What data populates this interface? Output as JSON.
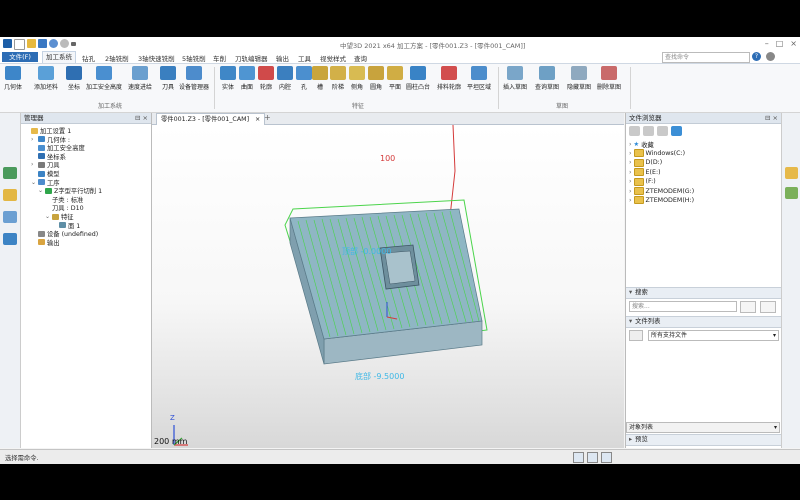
{
  "window": {
    "title": "中望3D 2021 x64        加工方案 - [零件001.Z3 - [零件001_CAM]]",
    "search_placeholder": "查找命令"
  },
  "menu": {
    "file": "文件(F)",
    "tabs": [
      "加工系统",
      "钻孔",
      "2轴铣削",
      "3轴快速铣削",
      "5轴铣削",
      "车削",
      "刀轨编辑器",
      "输出",
      "工具",
      "视觉样式",
      "查询"
    ]
  },
  "ribbon": {
    "system_buttons": [
      "几何体",
      "添加坯料",
      "坐标",
      "加工安全高度",
      "速度进给",
      "刀具",
      "设备管理器"
    ],
    "system_group": "加工系统",
    "feature_buttons": [
      "实体",
      "曲面",
      "轮廓",
      "内腔",
      "孔",
      "槽",
      "阶梯",
      "侧角",
      "圆角",
      "平面",
      "圆柱凸台",
      "排料轮廓",
      "平坦区域"
    ],
    "feature_group": "特征",
    "group3_buttons": [
      "插入草图",
      "查询草图",
      "隐藏草图",
      "删除草图"
    ],
    "group3_label": "草图"
  },
  "manager": {
    "title": "管理器",
    "tree": [
      {
        "label": "加工设置 1",
        "indent": 0,
        "icon": "folder-icon",
        "chev": ""
      },
      {
        "label": "几何体 :",
        "indent": 1,
        "icon": "geometry-icon",
        "chev": "›"
      },
      {
        "label": "加工安全高度",
        "indent": 1,
        "icon": "safe-height-icon",
        "chev": ""
      },
      {
        "label": "坐标系",
        "indent": 1,
        "icon": "coordinate-icon",
        "chev": ""
      },
      {
        "label": "刀具",
        "indent": 1,
        "icon": "tool-icon",
        "chev": "›"
      },
      {
        "label": "模型",
        "indent": 1,
        "icon": "model-icon",
        "chev": ""
      },
      {
        "label": "工序",
        "indent": 1,
        "icon": "operation-icon",
        "chev": "⌄"
      },
      {
        "label": "Z字型平行切削 1",
        "indent": 2,
        "icon": "check-icon",
        "chev": "⌄"
      },
      {
        "label": "子类 : 标准",
        "indent": 3,
        "icon": "",
        "chev": ""
      },
      {
        "label": "刀具 : D10",
        "indent": 3,
        "icon": "",
        "chev": ""
      },
      {
        "label": "特征",
        "indent": 3,
        "icon": "feature-icon",
        "chev": "⌄"
      },
      {
        "label": "面 1",
        "indent": 4,
        "icon": "face-icon",
        "chev": ""
      },
      {
        "label": "设备 (undefined)",
        "indent": 1,
        "icon": "device-icon",
        "chev": ""
      },
      {
        "label": "输出",
        "indent": 1,
        "icon": "output-icon",
        "chev": ""
      }
    ]
  },
  "doc": {
    "tab_label": "零件001.Z3 - [零件001_CAM]",
    "close": "×",
    "add": "+"
  },
  "viewport": {
    "dim_label": "100",
    "top_label": "顶部 -0.0000",
    "bottom_label": "底部 -9.5000",
    "scale_label": "200 mm",
    "axis_z": "Z"
  },
  "file_browser": {
    "title": "文件浏览器",
    "items": [
      "收藏",
      "Windows(C:)",
      "D(D:)",
      "E(E:)",
      "(F:)",
      "ZTEMODEM(G:)",
      "ZTEMODEM(H:)"
    ],
    "search_header": "搜索",
    "search_placeholder": "搜索...",
    "file_list_header": "文件列表",
    "filter_value": "所有支持文件",
    "object_list": "对象列表",
    "preview": "预览"
  },
  "status": {
    "text": "选择需命令."
  },
  "colors": {
    "accent": "#2d6db5",
    "part": "#8fb6c4",
    "toolpath": "#4bd44b",
    "dim_red": "#d43a3a"
  }
}
